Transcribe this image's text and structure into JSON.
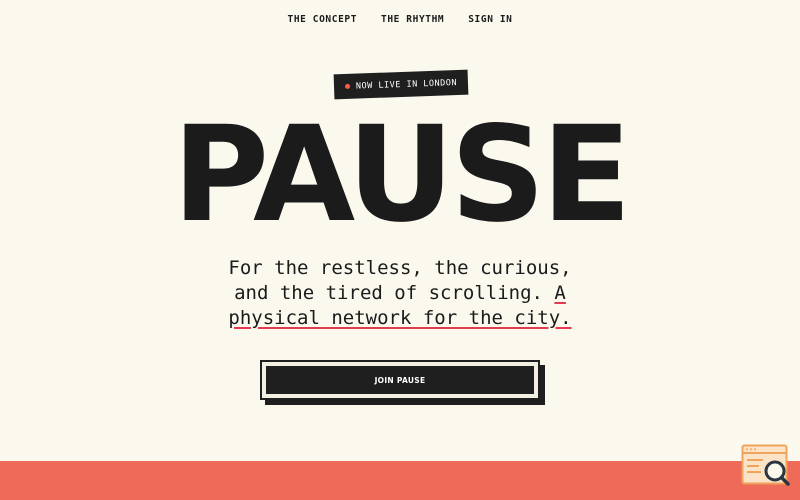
{
  "nav": {
    "items": [
      {
        "label": "THE CONCEPT"
      },
      {
        "label": "THE RHYTHM"
      },
      {
        "label": "SIGN IN"
      }
    ]
  },
  "badge": {
    "label": "NOW LIVE IN LONDON"
  },
  "hero": {
    "title": "PAUSE",
    "subtitle_line1": "For the restless, the curious,",
    "subtitle_line2": "and the tired of scrolling.",
    "subtitle_line2_highlight": "A",
    "subtitle_line3": "physical network for the city."
  },
  "cta": {
    "label": "JOIN PAUSE"
  },
  "colors": {
    "background": "#fbf8ee",
    "ink": "#1b1b1b",
    "accent": "#ef6b59",
    "underline": "#e23a4e",
    "dot": "#ff5a4a"
  },
  "icons": {
    "widget": "search-window-icon"
  }
}
